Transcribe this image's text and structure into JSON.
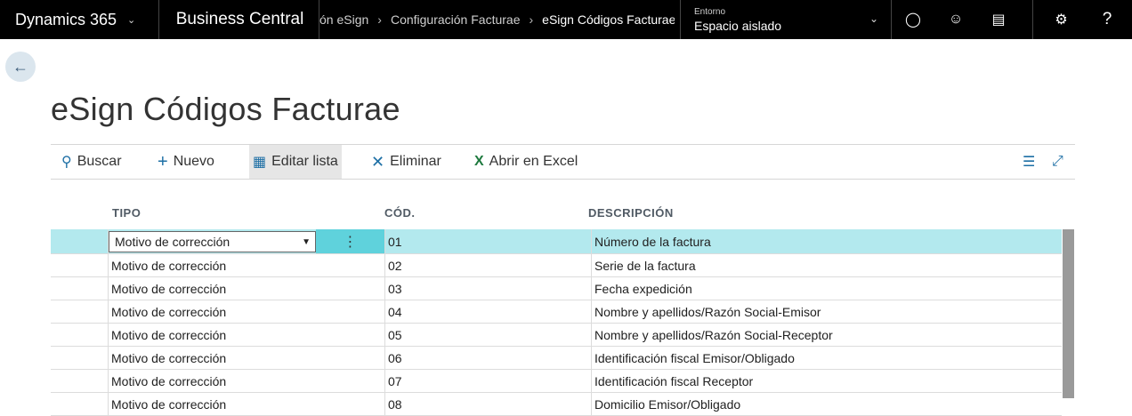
{
  "topbar": {
    "app_name": "Dynamics 365",
    "product": "Business Central",
    "breadcrumbs": [
      "ón eSign",
      "Configuración Facturae",
      "eSign Códigos Facturae"
    ],
    "env_label": "Entorno",
    "env_value": "Espacio aislado",
    "icons": [
      "lightbulb-icon",
      "smiley-icon",
      "feedback-icon",
      "gear-icon",
      "help-icon"
    ]
  },
  "page": {
    "title": "eSign Códigos Facturae"
  },
  "actions": {
    "search": "Buscar",
    "new": "Nuevo",
    "edit_list": "Editar lista",
    "delete": "Eliminar",
    "open_excel": "Abrir en Excel"
  },
  "table": {
    "headers": {
      "tipo": "TIPO",
      "cod": "CÓD.",
      "descripcion": "DESCRIPCIÓN"
    },
    "rows": [
      {
        "tipo": "Motivo de corrección",
        "cod": "01",
        "descripcion": "Número de la factura"
      },
      {
        "tipo": "Motivo de corrección",
        "cod": "02",
        "descripcion": "Serie de la factura"
      },
      {
        "tipo": "Motivo de corrección",
        "cod": "03",
        "descripcion": "Fecha expedición"
      },
      {
        "tipo": "Motivo de corrección",
        "cod": "04",
        "descripcion": "Nombre y apellidos/Razón Social-Emisor"
      },
      {
        "tipo": "Motivo de corrección",
        "cod": "05",
        "descripcion": "Nombre y apellidos/Razón Social-Receptor"
      },
      {
        "tipo": "Motivo de corrección",
        "cod": "06",
        "descripcion": "Identificación fiscal Emisor/Obligado"
      },
      {
        "tipo": "Motivo de corrección",
        "cod": "07",
        "descripcion": "Identificación fiscal Receptor"
      },
      {
        "tipo": "Motivo de corrección",
        "cod": "08",
        "descripcion": "Domicilio Emisor/Obligado"
      }
    ],
    "selected_row": 0
  },
  "colors": {
    "selected_row": "#b3e9ee",
    "dots_cell": "#5fd2dc",
    "topbar": "#000000"
  }
}
